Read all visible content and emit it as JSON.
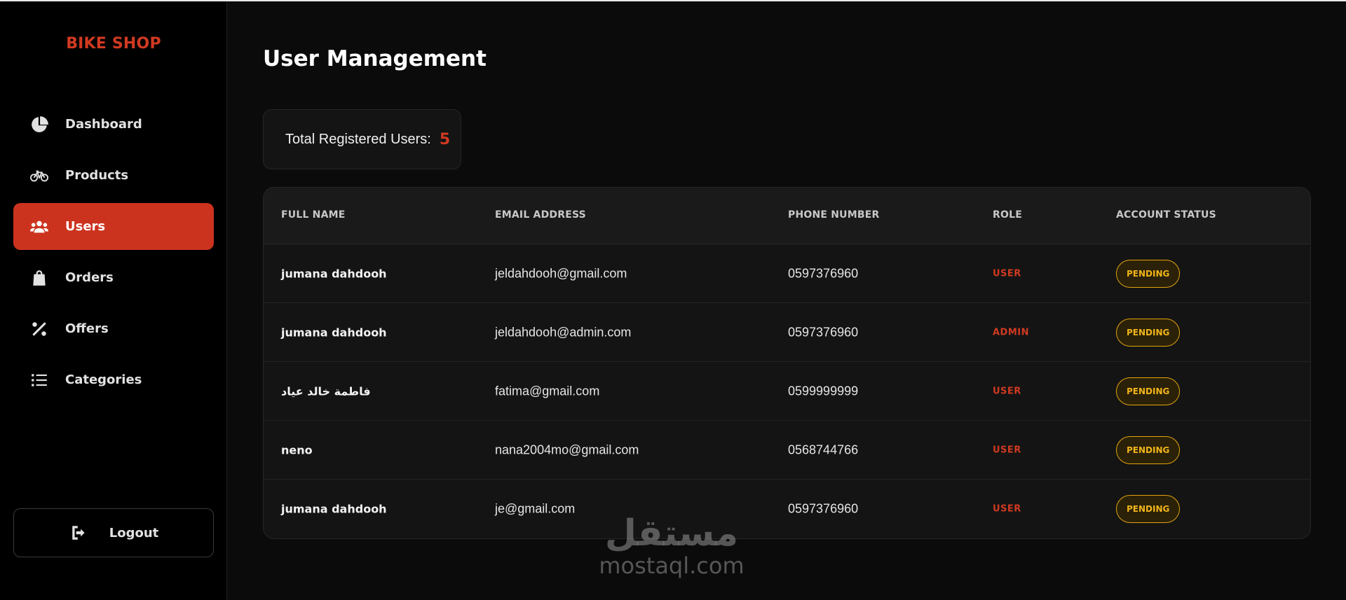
{
  "brand": "BIKE SHOP",
  "sidebar": {
    "items": [
      {
        "label": "Dashboard",
        "icon": "pie-chart-icon",
        "active": false
      },
      {
        "label": "Products",
        "icon": "bicycle-icon",
        "active": false
      },
      {
        "label": "Users",
        "icon": "users-icon",
        "active": true
      },
      {
        "label": "Orders",
        "icon": "shopping-bag-icon",
        "active": false
      },
      {
        "label": "Offers",
        "icon": "percent-icon",
        "active": false
      },
      {
        "label": "Categories",
        "icon": "list-icon",
        "active": false
      }
    ],
    "logout": {
      "label": "Logout",
      "icon": "sign-out-icon"
    }
  },
  "main": {
    "title": "User Management",
    "stats": {
      "label": "Total Registered Users:",
      "value": "5"
    },
    "table": {
      "headers": [
        "FULL NAME",
        "EMAIL ADDRESS",
        "PHONE NUMBER",
        "ROLE",
        "ACCOUNT STATUS"
      ],
      "rows": [
        {
          "name": "jumana dahdooh",
          "email": "jeldahdooh@gmail.com",
          "phone": "0597376960",
          "role": "USER",
          "status": "PENDING"
        },
        {
          "name": "jumana dahdooh",
          "email": "jeldahdooh@admin.com",
          "phone": "0597376960",
          "role": "ADMIN",
          "status": "PENDING"
        },
        {
          "name": "فاطمة خالد عياد",
          "email": "fatima@gmail.com",
          "phone": "0599999999",
          "role": "USER",
          "status": "PENDING"
        },
        {
          "name": "neno",
          "email": "nana2004mo@gmail.com",
          "phone": "0568744766",
          "role": "USER",
          "status": "PENDING"
        },
        {
          "name": "jumana dahdooh",
          "email": "je@gmail.com",
          "phone": "0597376960",
          "role": "USER",
          "status": "PENDING"
        }
      ]
    }
  },
  "watermark": {
    "arabic": "مستقل",
    "latin": "mostaql.com"
  },
  "colors": {
    "accent": "#cc331e",
    "status_pending": "#f2b41a",
    "background": "#0b0b0b",
    "sidebar": "#000000"
  }
}
